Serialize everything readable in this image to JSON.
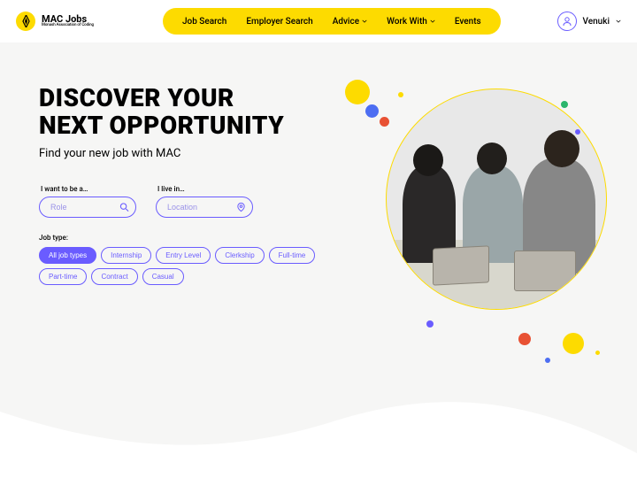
{
  "brand": {
    "title": "MAC Jobs",
    "subtitle": "Monash Association of Coding"
  },
  "nav": {
    "items": [
      {
        "label": "Job Search",
        "has_dropdown": false
      },
      {
        "label": "Employer Search",
        "has_dropdown": false
      },
      {
        "label": "Advice",
        "has_dropdown": true
      },
      {
        "label": "Work With",
        "has_dropdown": true
      },
      {
        "label": "Events",
        "has_dropdown": false
      }
    ]
  },
  "user": {
    "name": "Venuki"
  },
  "hero": {
    "title_line1": "DISCOVER YOUR",
    "title_line2": "NEXT OPPORTUNITY",
    "subtitle": "Find your new job with MAC"
  },
  "search": {
    "role_label": "I want to be a…",
    "role_placeholder": "Role",
    "location_label": "I live in…",
    "location_placeholder": "Location"
  },
  "job_types": {
    "label": "Job type:",
    "options": [
      {
        "label": "All job types",
        "active": true
      },
      {
        "label": "Internship",
        "active": false
      },
      {
        "label": "Entry Level",
        "active": false
      },
      {
        "label": "Clerkship",
        "active": false
      },
      {
        "label": "Full-time",
        "active": false
      },
      {
        "label": "Part-time",
        "active": false
      },
      {
        "label": "Contract",
        "active": false
      },
      {
        "label": "Casual",
        "active": false
      }
    ]
  },
  "colors": {
    "accent_yellow": "#fddb00",
    "accent_purple": "#6a5cff"
  }
}
